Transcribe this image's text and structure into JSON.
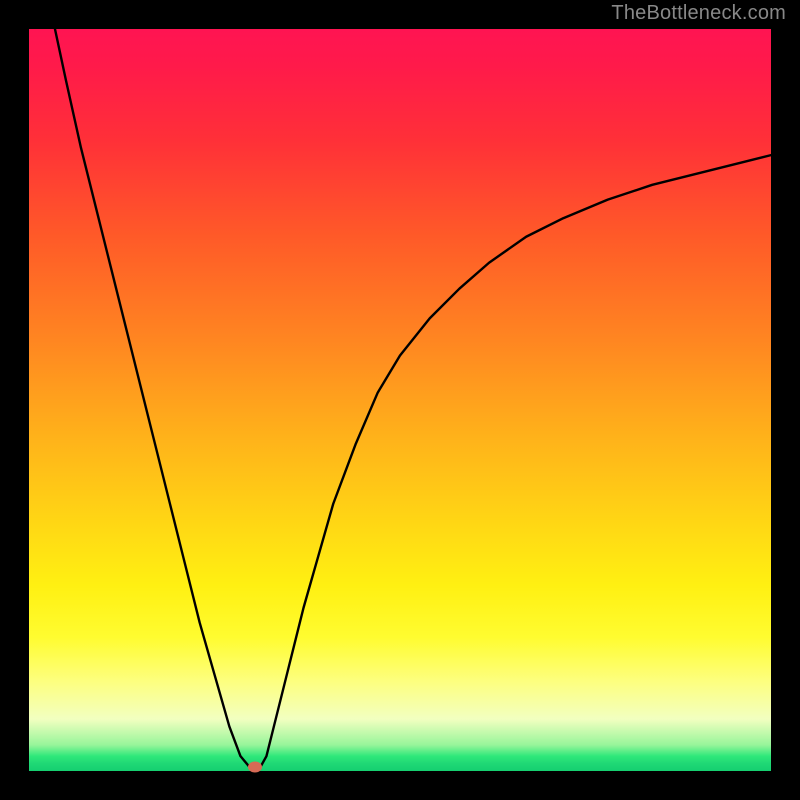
{
  "attribution": "TheBottleneck.com",
  "colors": {
    "outer_bg": "#000000",
    "curve_stroke": "#000000",
    "marker_fill": "#d66a55",
    "gradient_top": "#ff1452",
    "gradient_bottom": "#15cf70"
  },
  "chart_data": {
    "type": "line",
    "title": "",
    "xlabel": "",
    "ylabel": "",
    "xlim": [
      0,
      100
    ],
    "ylim": [
      0,
      100
    ],
    "x": [
      3.5,
      5,
      7,
      9,
      11,
      13,
      15,
      17,
      19,
      21,
      23,
      25,
      27,
      28.5,
      30,
      31,
      32,
      33,
      35,
      37,
      39,
      41,
      44,
      47,
      50,
      54,
      58,
      62,
      67,
      72,
      78,
      84,
      90,
      96,
      100
    ],
    "y": [
      100,
      93,
      84,
      76,
      68,
      60,
      52,
      44,
      36,
      28,
      20,
      13,
      6,
      2,
      0.2,
      0.2,
      2,
      6,
      14,
      22,
      29,
      36,
      44,
      51,
      56,
      61,
      65,
      68.5,
      72,
      74.5,
      77,
      79,
      80.5,
      82,
      83
    ],
    "marker": {
      "x": 30.5,
      "y": 0.5
    },
    "annotations": []
  }
}
